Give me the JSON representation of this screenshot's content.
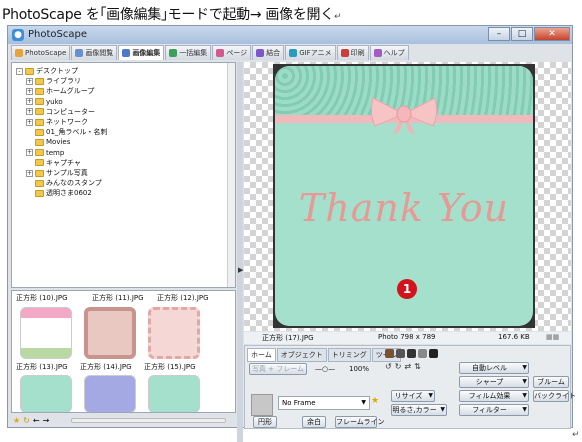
{
  "caption": {
    "text": "PhotoScape を｢画像編集｣モードで起動→ 画像を開く",
    "return_mark": "↵"
  },
  "window": {
    "title": "PhotoScape",
    "buttons": [
      "–",
      "□",
      "✕"
    ]
  },
  "tabs": [
    {
      "label": "PhotoScape",
      "icon": "photoscape-icon",
      "color": "#e8a23a"
    },
    {
      "label": "画像閲覧",
      "icon": "viewer-icon",
      "color": "#6a8fcf"
    },
    {
      "label": "画像編集",
      "icon": "editor-icon",
      "color": "#4c7ac4",
      "active": true
    },
    {
      "label": "一括編集",
      "icon": "batch-icon",
      "color": "#3f9d5a"
    },
    {
      "label": "ページ",
      "icon": "page-icon",
      "color": "#d05a8a"
    },
    {
      "label": "結合",
      "icon": "combine-icon",
      "color": "#7b57c9"
    },
    {
      "label": "GIFアニメ",
      "icon": "gif-icon",
      "color": "#2a9bbf"
    },
    {
      "label": "印刷",
      "icon": "print-icon",
      "color": "#c9403a"
    },
    {
      "label": "ヘルプ",
      "icon": "help-icon",
      "color": "#a15bc2"
    }
  ],
  "tree": [
    {
      "label": "デスクトップ",
      "expander": "-",
      "level": 0,
      "icon": "desktop-icon"
    },
    {
      "label": "ライブラリ",
      "expander": "+",
      "level": 1,
      "icon": "library-icon"
    },
    {
      "label": "ホームグループ",
      "expander": "+",
      "level": 1,
      "icon": "homegroup-icon"
    },
    {
      "label": "yuko",
      "expander": "+",
      "level": 1,
      "icon": "user-folder-icon"
    },
    {
      "label": "コンピューター",
      "expander": "+",
      "level": 1,
      "icon": "computer-icon"
    },
    {
      "label": "ネットワーク",
      "expander": "+",
      "level": 1,
      "icon": "network-icon"
    },
    {
      "label": "01_角ラベル・名刺",
      "expander": "",
      "level": 1,
      "icon": "folder-icon"
    },
    {
      "label": "Movies",
      "expander": "",
      "level": 1,
      "icon": "folder-icon"
    },
    {
      "label": "temp",
      "expander": "+",
      "level": 1,
      "icon": "folder-icon"
    },
    {
      "label": "キャプチャ",
      "expander": "",
      "level": 1,
      "icon": "folder-icon"
    },
    {
      "label": "サンプル写真",
      "expander": "+",
      "level": 1,
      "icon": "folder-icon"
    },
    {
      "label": "みんなのスタンプ",
      "expander": "",
      "level": 1,
      "icon": "folder-icon"
    },
    {
      "label": "透明さま0602",
      "expander": "",
      "level": 1,
      "icon": "folder-icon"
    }
  ],
  "thumbnails": {
    "top_row_labels": [
      "正方形 (10).JPG",
      "正方形 (11).JPG",
      "正方形 (12).JPG"
    ],
    "row1_labels": [
      "正方形 (13).JPG",
      "正方形 (14).JPG",
      "正方形 (15).JPG"
    ]
  },
  "editor": {
    "thank_text": "Thank You",
    "badge": "1",
    "file_name": "正方形 (17).JPG",
    "photo_size": "Photo 798 x 789",
    "file_size": "167.6 KB"
  },
  "controls": {
    "tabs": [
      "ホーム",
      "オブジェクト",
      "トリミング",
      "ツール"
    ],
    "photo_frame": "写真 + フレーム",
    "zoom": "100%",
    "frame": "No Frame",
    "buttons": {
      "round": "円形",
      "margin": "余白",
      "frame_line": "フレームライン",
      "auto_level": "自動レベル",
      "sharpen": "シャープ",
      "resize": "リサイズ",
      "film_effect": "フィルム効果",
      "brightness": "明るさ,カラー",
      "filter": "フィルター",
      "bloom": "ブルーム",
      "backlight": "バックライト"
    }
  },
  "colors": {
    "card_mint": "#a4e0cc",
    "pink": "#e59a96",
    "badge_red": "#d4121b"
  }
}
